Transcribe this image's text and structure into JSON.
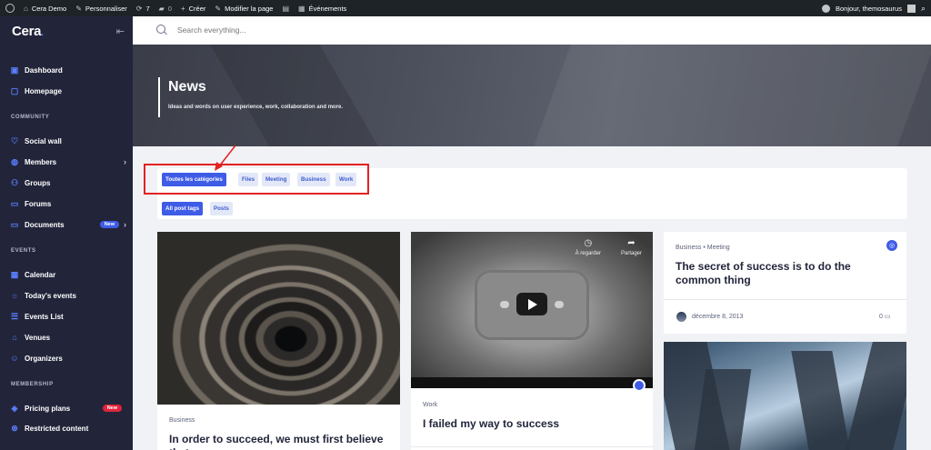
{
  "adminbar": {
    "site": "Cera Demo",
    "customize": "Personnaliser",
    "updates": "7",
    "comments": "0",
    "create": "Créer",
    "edit_page": "Modifier la page",
    "events": "Événements",
    "greeting": "Bonjour, themosaurus"
  },
  "sidebar": {
    "logo": "Cera",
    "sections": {
      "community": "COMMUNITY",
      "events": "EVENTS",
      "membership": "MEMBERSHIP"
    },
    "items": [
      {
        "label": "Dashboard",
        "icon": "dashboard-icon"
      },
      {
        "label": "Homepage",
        "icon": "homepage-icon"
      },
      {
        "label": "Social wall",
        "icon": "heart-icon"
      },
      {
        "label": "Members",
        "icon": "globe-icon"
      },
      {
        "label": "Groups",
        "icon": "groups-icon"
      },
      {
        "label": "Forums",
        "icon": "chat-icon"
      },
      {
        "label": "Documents",
        "icon": "folder-icon",
        "badge": "New"
      },
      {
        "label": "Calendar",
        "icon": "calendar-icon"
      },
      {
        "label": "Today's events",
        "icon": "sun-icon"
      },
      {
        "label": "Events List",
        "icon": "list-icon"
      },
      {
        "label": "Venues",
        "icon": "home-icon"
      },
      {
        "label": "Organizers",
        "icon": "user-icon"
      },
      {
        "label": "Pricing plans",
        "icon": "tag-icon",
        "badge": "New"
      },
      {
        "label": "Restricted content",
        "icon": "lock-icon"
      }
    ]
  },
  "search": {
    "placeholder": "Search everything..."
  },
  "hero": {
    "title": "News",
    "subtitle": "Ideas and words on user experience, work, collaboration and more."
  },
  "filters": {
    "categories": [
      "Toutes les catégories",
      "Files",
      "Meeting",
      "Business",
      "Work"
    ],
    "tags": [
      "All post tags",
      "Posts"
    ]
  },
  "posts": {
    "p1": {
      "category": "Business",
      "title": "In order to succeed, we must first believe that we can"
    },
    "p2": {
      "category": "Work",
      "title": "I failed my way to success",
      "watch_later": "À regarder",
      "share": "Partager"
    },
    "p3": {
      "category": "Business",
      "category2": "Meeting",
      "title": "The secret of success is to do the common thing",
      "date": "décembre 8, 2013",
      "comments": "0"
    }
  }
}
